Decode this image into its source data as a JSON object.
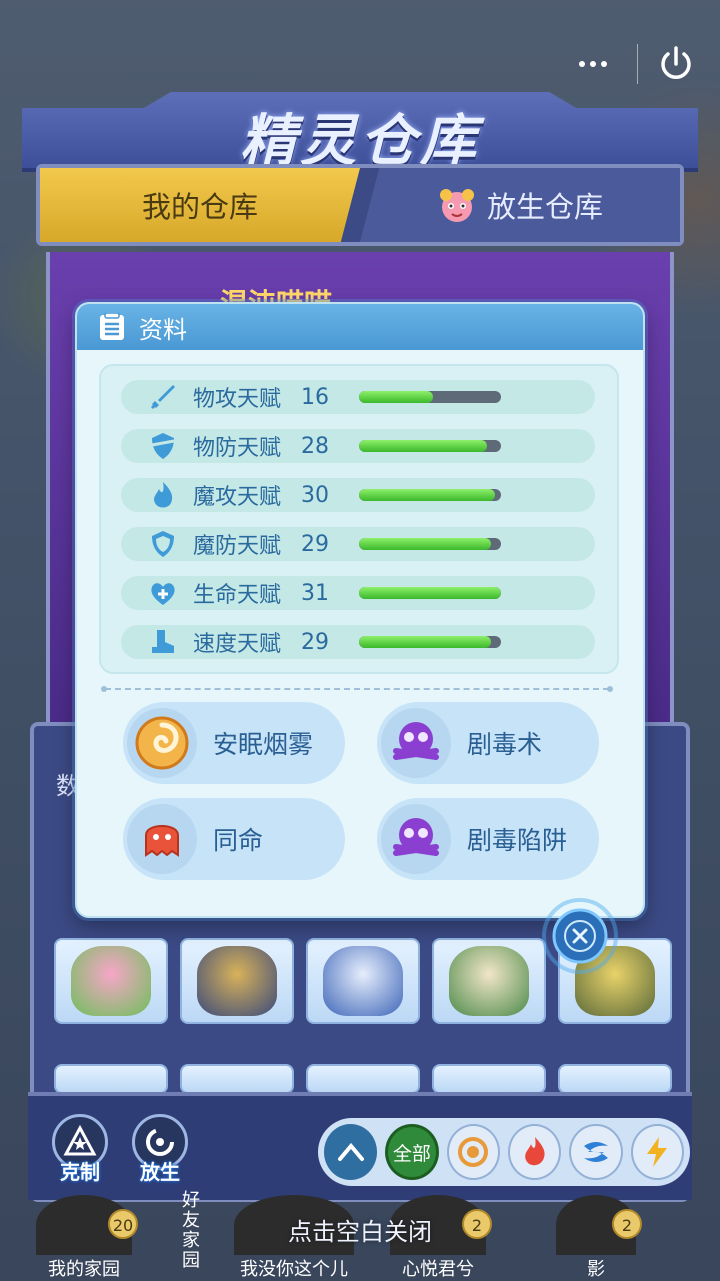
{
  "header": {
    "more_label": "•••",
    "power_label": "power"
  },
  "warehouse": {
    "title": "精灵仓库",
    "tabs": [
      {
        "label": "我的仓库",
        "active": true
      },
      {
        "label": "放生仓库",
        "active": false
      }
    ],
    "pet_name": "混沌喵喵",
    "grid_label": "数"
  },
  "modal": {
    "title": "资料",
    "stats": [
      {
        "icon": "sword-icon",
        "label": "物攻天赋",
        "value": "16",
        "fill": 0.52
      },
      {
        "icon": "shield-icon",
        "label": "物防天赋",
        "value": "28",
        "fill": 0.9
      },
      {
        "icon": "flame-icon",
        "label": "魔攻天赋",
        "value": "30",
        "fill": 0.96
      },
      {
        "icon": "magic-shield-icon",
        "label": "魔防天赋",
        "value": "29",
        "fill": 0.93
      },
      {
        "icon": "heart-plus-icon",
        "label": "生命天赋",
        "value": "31",
        "fill": 1.0
      },
      {
        "icon": "boot-icon",
        "label": "速度天赋",
        "value": "29",
        "fill": 0.93
      }
    ],
    "skills": [
      {
        "label": "安眠烟雾",
        "icon": "swirl-smoke-icon"
      },
      {
        "label": "剧毒术",
        "icon": "poison-skull-icon"
      },
      {
        "label": "同命",
        "icon": "red-ghost-icon"
      },
      {
        "label": "剧毒陷阱",
        "icon": "poison-skull-icon"
      }
    ]
  },
  "bottom": {
    "counter_label": "克制",
    "release_label": "放生",
    "filter_all": "全部",
    "filter_up": "^"
  },
  "hint": "点击空白关闭",
  "friends": [
    {
      "name": "我的家园",
      "badge": "20"
    },
    {
      "name": "好友家园",
      "badge": ""
    },
    {
      "name": "我没你这个儿",
      "badge": ""
    },
    {
      "name": "心悦君兮",
      "badge": "2"
    },
    {
      "name": "影",
      "badge": "2"
    }
  ],
  "colors": {
    "accent_blue": "#4a98d4",
    "bar_green": "#3ab82c",
    "tab_gold": "#f2c94c"
  }
}
